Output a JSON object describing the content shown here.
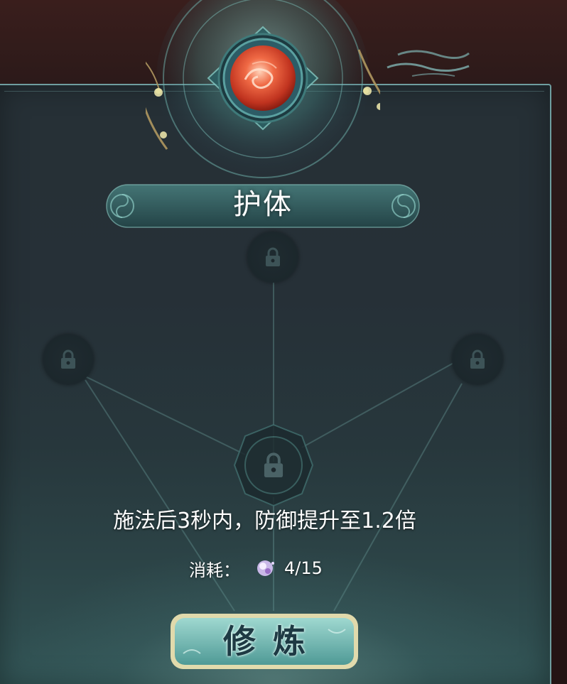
{
  "skill": {
    "title": "护体",
    "description": "施法后3秒内，防御提升至1.2倍"
  },
  "cost": {
    "label": "消耗：",
    "item_icon": "spirit-pearl-icon",
    "amount": "4/15"
  },
  "action": {
    "label": "修炼"
  },
  "tree": {
    "nodes": [
      {
        "name": "top",
        "state": "locked"
      },
      {
        "name": "left",
        "state": "locked"
      },
      {
        "name": "right",
        "state": "locked"
      },
      {
        "name": "center",
        "state": "locked"
      }
    ]
  },
  "colors": {
    "panel_border": "#6f9ea0",
    "panel_bg": "#263036",
    "accent_teal": "#4fa3a0",
    "orb_red": "#d8452c",
    "button_frame": "#f2e6b0"
  }
}
